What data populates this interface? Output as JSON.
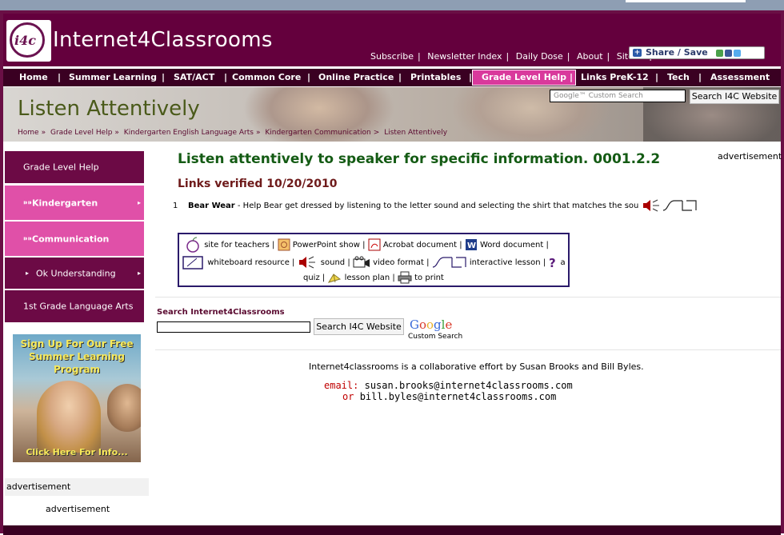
{
  "header": {
    "logo_text": "i4c",
    "site_name": "Internet4Classrooms",
    "links": [
      "Subscribe",
      "Newsletter Index",
      "Daily Dose",
      "About",
      "Site Map"
    ],
    "share_label": "Share / Save"
  },
  "nav": {
    "items": [
      "Home",
      "Summer Learning",
      "SAT/ACT",
      "Common Core",
      "Online Practice",
      "Printables",
      "Grade Level Help",
      "Links PreK-12",
      "Tech",
      "Assessment"
    ],
    "active": "Grade Level Help"
  },
  "banner": {
    "title": "Listen Attentively",
    "breadcrumb": [
      "Home",
      "Grade Level Help",
      "Kindergarten English Language Arts",
      "Kindergarten Communication",
      "Listen Attentively"
    ],
    "search_placeholder": "Google™ Custom Search",
    "search_button": "Search I4C Website"
  },
  "sidebar": {
    "items": [
      {
        "label": "Grade Level Help",
        "style": "dark"
      },
      {
        "label": "Kindergarten",
        "style": "pink"
      },
      {
        "label": "Communication",
        "style": "pink"
      },
      {
        "label": "Ok Understanding",
        "style": "dark"
      },
      {
        "label": "1st Grade Language Arts",
        "style": "dark"
      }
    ],
    "promo": {
      "headline": "Sign Up For Our Free Summer Learning Program",
      "footer": "Click Here For Info..."
    },
    "ad_label": "advertisement",
    "ad_label_2": "advertisement"
  },
  "main": {
    "title": "Listen attentively to speaker for specific information. 0001.2.2",
    "ad_label": "advertisement",
    "verified": "Links verified 10/20/2010",
    "links": [
      {
        "num": "1",
        "name": "Bear Wear",
        "desc": " - Help Bear get dressed by listening to the letter sound and selecting the shirt that matches the sou"
      }
    ],
    "legend": {
      "site_for_teachers": "site for teachers",
      "powerpoint": "PowerPoint show",
      "acrobat": "Acrobat document",
      "word": "Word document",
      "whiteboard": "whiteboard resource",
      "sound": "sound",
      "video": "video format",
      "interactive": "interactive lesson",
      "quiz_a": "a",
      "quiz_b": "quiz",
      "lesson_plan": "lesson plan",
      "print": "to print"
    },
    "search": {
      "label": "Search Internet4Classrooms",
      "button": "Search I4C Website",
      "google": "Google",
      "google_sub": "Custom Search"
    },
    "collab": "Internet4classrooms is a collaborative effort by Susan Brooks and Bill Byles.",
    "email_label": "email:",
    "email1": "susan.brooks@internet4classrooms.com",
    "or_label": "or",
    "email2": "bill.byles@internet4classrooms.com"
  },
  "colors": {
    "brand": "#64003d",
    "nav_bg": "#3a0022",
    "active_nav": "#d9399c",
    "sidebar_dark": "#6c0a45",
    "sidebar_pink": "#e050a8",
    "title_green": "#145b14"
  }
}
